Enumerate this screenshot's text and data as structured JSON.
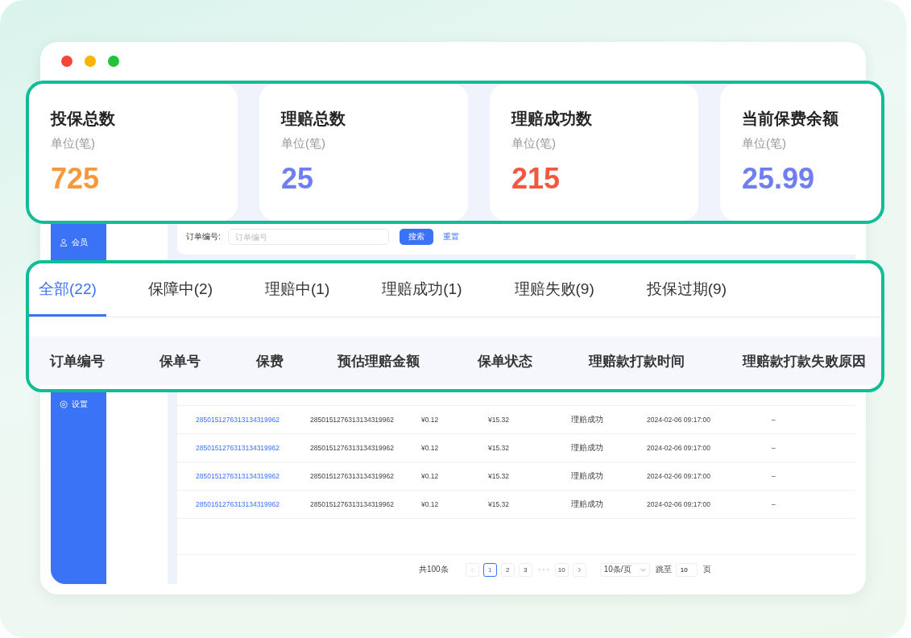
{
  "sidebar": {
    "items": [
      {
        "label": "会员",
        "kind": "user"
      },
      {
        "label": "设置",
        "kind": "gear"
      }
    ]
  },
  "search": {
    "label": "订单编号:",
    "placeholder": "订单编号",
    "search_button": "搜索",
    "reset_button": "重置"
  },
  "table": {
    "rows": [
      {
        "order_no": "2850151276313134319962",
        "policy_no": "2850151276313134319962",
        "premium": "¥0.12",
        "estimated_amount": "¥15.32",
        "status": "理赔成功",
        "payment_time": "2024-02-06 09:17:00",
        "failure_reason": "–"
      },
      {
        "order_no": "2850151276313134319962",
        "policy_no": "2850151276313134319962",
        "premium": "¥0.12",
        "estimated_amount": "¥15.32",
        "status": "理赔成功",
        "payment_time": "2024-02-06 09:17:00",
        "failure_reason": "–"
      },
      {
        "order_no": "2850151276313134319962",
        "policy_no": "2850151276313134319962",
        "premium": "¥0.12",
        "estimated_amount": "¥15.32",
        "status": "理赔成功",
        "payment_time": "2024-02-06 09:17:00",
        "failure_reason": "–"
      },
      {
        "order_no": "2850151276313134319962",
        "policy_no": "2850151276313134319962",
        "premium": "¥0.12",
        "estimated_amount": "¥15.32",
        "status": "理赔成功",
        "payment_time": "2024-02-06 09:17:00",
        "failure_reason": "–"
      }
    ]
  },
  "pagination": {
    "total": "共100条",
    "pages": [
      {
        "label": "1",
        "selected": true
      },
      {
        "label": "2",
        "selected": false
      },
      {
        "label": "3",
        "selected": false
      },
      {
        "label": "10",
        "selected": false,
        "after_ellipsis": true
      }
    ],
    "page_size": "10条/页",
    "jump_label": "跳至",
    "jump_value": "10",
    "page_unit": "页"
  },
  "stats": [
    {
      "title": "投保总数",
      "unit": "单位(笔)",
      "value": "725",
      "color": "#f7983a"
    },
    {
      "title": "理赔总数",
      "unit": "单位(笔)",
      "value": "25",
      "color": "#6f7ef0"
    },
    {
      "title": "理赔成功数",
      "unit": "单位(笔)",
      "value": "215",
      "color": "#f2573f"
    },
    {
      "title": "当前保费余额",
      "unit": "单位(笔)",
      "value": "25.99",
      "color": "#6f7ef0"
    }
  ],
  "tabs": [
    {
      "label": "全部(22)",
      "selected": true
    },
    {
      "label": "保障中(2)",
      "selected": false
    },
    {
      "label": "理赔中(1)",
      "selected": false
    },
    {
      "label": "理赔成功(1)",
      "selected": false
    },
    {
      "label": "理赔失败(9)",
      "selected": false
    },
    {
      "label": "投保过期(9)",
      "selected": false
    }
  ],
  "columns": [
    "订单编号",
    "保单号",
    "保费",
    "预估理赔金额",
    "保单状态",
    "理赔款打款时间",
    "理赔款打款失败原因"
  ]
}
